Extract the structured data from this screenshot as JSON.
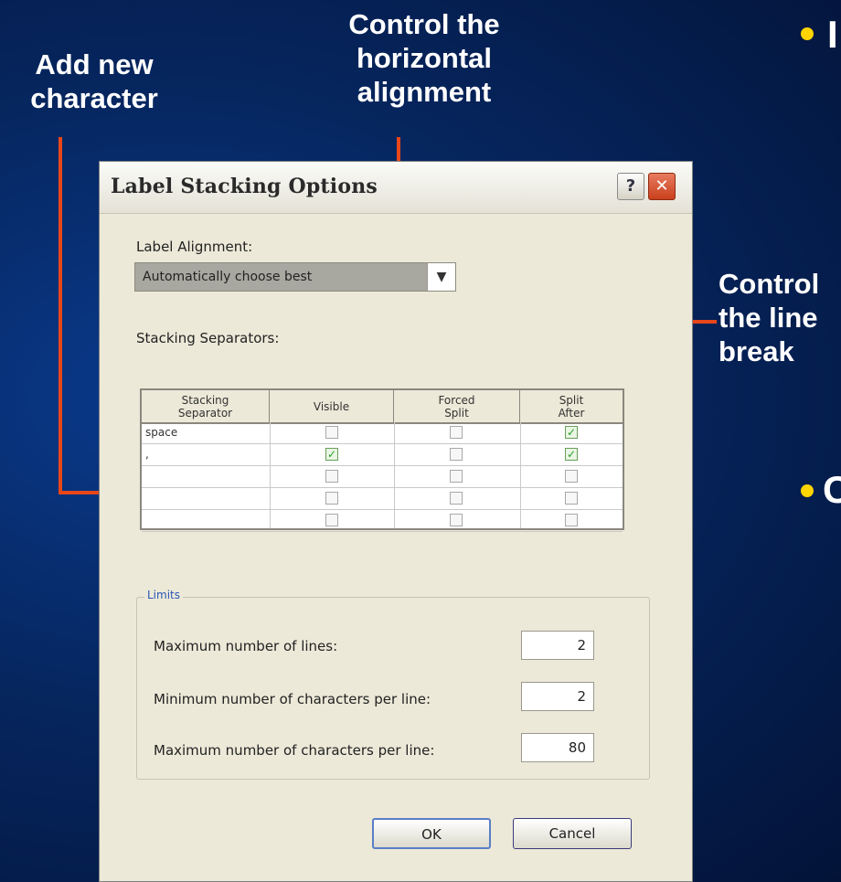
{
  "callouts": {
    "add_new": [
      "Add new",
      "character"
    ],
    "horizontal": [
      "Control the",
      "horizontal",
      "alignment"
    ],
    "line_break": [
      "Control",
      "the line",
      "break"
    ]
  },
  "colors": {
    "arrow": "#e8471a",
    "bullet": "#ffd400"
  },
  "dialog": {
    "title": "Label Stacking Options",
    "help_glyph": "?",
    "close_glyph": "✕",
    "alignment_label": "Label Alignment:",
    "alignment_value": "Automatically choose best",
    "separators_label": "Stacking Separators:",
    "columns": [
      [
        "Stacking",
        "Separator"
      ],
      [
        "Visible"
      ],
      [
        "Forced",
        "Split"
      ],
      [
        "Split",
        "After"
      ]
    ],
    "rows": [
      {
        "separator": "space",
        "visible": false,
        "forced": false,
        "split_after": true
      },
      {
        "separator": ",",
        "visible": true,
        "forced": false,
        "split_after": true
      },
      {
        "separator": "",
        "visible": false,
        "forced": false,
        "split_after": false
      },
      {
        "separator": "",
        "visible": false,
        "forced": false,
        "split_after": false
      },
      {
        "separator": "",
        "visible": false,
        "forced": false,
        "split_after": false
      }
    ],
    "limits": {
      "legend": "Limits",
      "max_lines_label": "Maximum number of lines:",
      "max_lines": "2",
      "min_chars_label": "Minimum number of characters per line:",
      "min_chars": "2",
      "max_chars_label": "Maximum number of characters per line:",
      "max_chars": "80"
    },
    "ok": "OK",
    "cancel": "Cancel"
  }
}
